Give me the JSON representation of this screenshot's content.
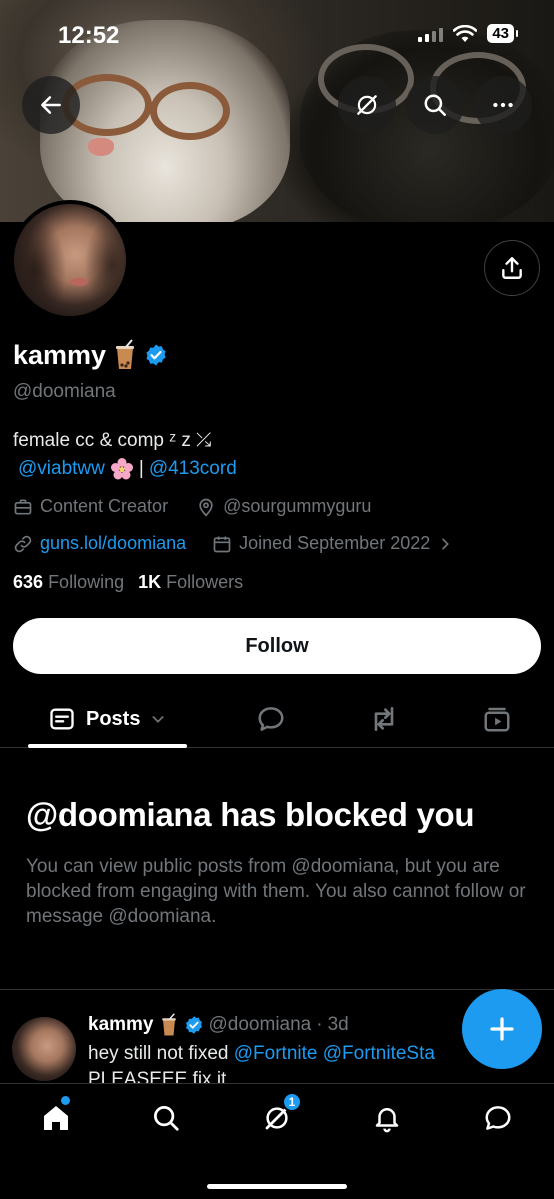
{
  "status_bar": {
    "time": "12:52",
    "battery": "43"
  },
  "profile": {
    "name": "kammy",
    "handle": "@doomiana",
    "bio": "female cc & comp ᶻ z ⤰",
    "bio_link_1": "@viabtww",
    "bio_separator": "|",
    "bio_link_2": "@413cord",
    "category": "Content Creator",
    "location": "@sourgummyguru",
    "website": "guns.lol/doomiana",
    "joined": "Joined September 2022",
    "following_count": "636",
    "following_label": "Following",
    "followers_count": "1K",
    "followers_label": "Followers"
  },
  "follow_button": {
    "label": "Follow"
  },
  "tabs": {
    "posts_label": "Posts"
  },
  "blocked": {
    "title": "@doomiana has blocked you",
    "body": "You can view public posts from @doomiana, but you are blocked from engaging with them. You also cannot follow or message @doomiana."
  },
  "post_preview": {
    "name": "kammy",
    "handle": "@doomiana",
    "separator": "·",
    "time": "3d",
    "text_prefix": "hey still not fixed ",
    "mention_1": "@Fortnite",
    "mention_2": "@FortniteSta",
    "text_line_2": "PLEASEEE fix it"
  },
  "bottom_nav": {
    "grok_badge": "1"
  },
  "colors": {
    "accent": "#1d9bf0",
    "background": "#000000",
    "muted": "#71767b"
  }
}
